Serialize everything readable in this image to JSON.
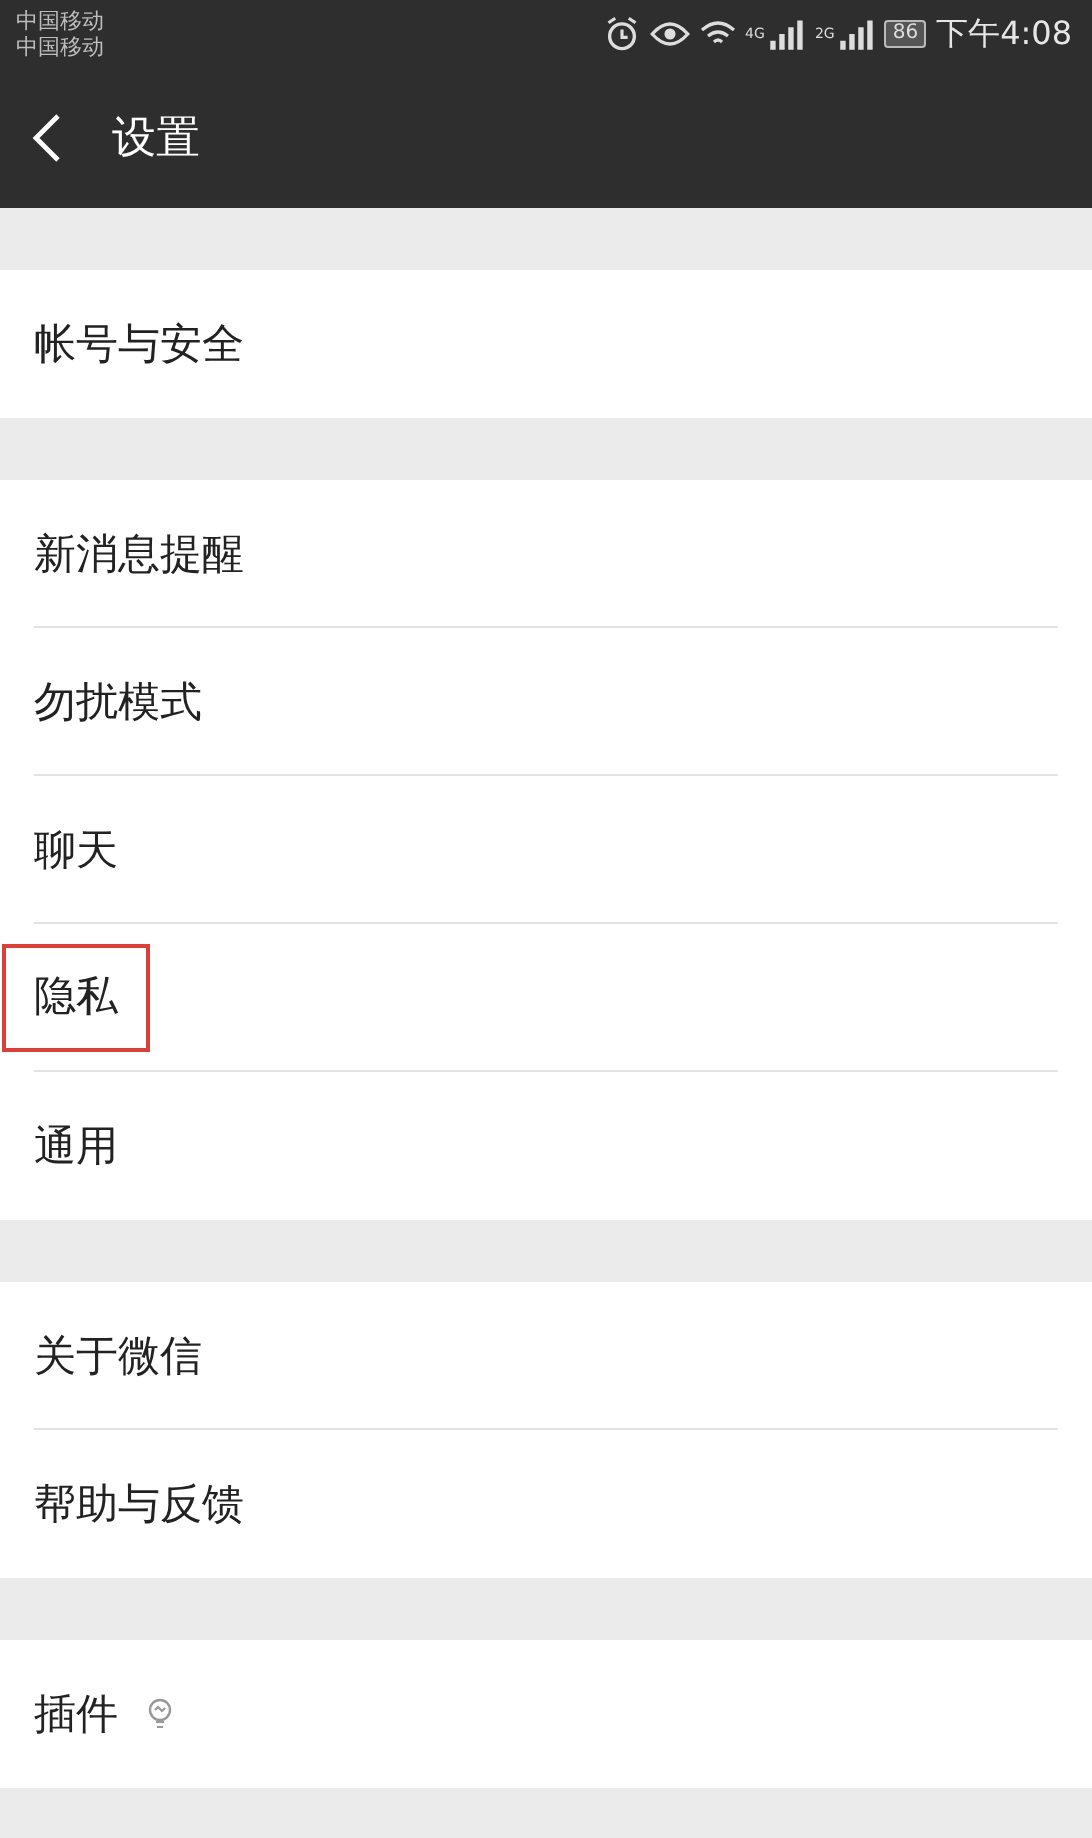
{
  "status_bar": {
    "carriers": [
      "中国移动",
      "中国移动"
    ],
    "network_1": "4G",
    "network_2": "2G",
    "battery": "86",
    "time": "下午4:08"
  },
  "nav_bar": {
    "title": "设置"
  },
  "groups": [
    {
      "items": [
        {
          "label": "帐号与安全",
          "highlighted": false
        }
      ]
    },
    {
      "items": [
        {
          "label": "新消息提醒",
          "highlighted": false
        },
        {
          "label": "勿扰模式",
          "highlighted": false
        },
        {
          "label": "聊天",
          "highlighted": false
        },
        {
          "label": "隐私",
          "highlighted": true
        },
        {
          "label": "通用",
          "highlighted": false
        }
      ]
    },
    {
      "items": [
        {
          "label": "关于微信",
          "highlighted": false
        },
        {
          "label": "帮助与反馈",
          "highlighted": false
        }
      ]
    },
    {
      "items": [
        {
          "label": "插件",
          "highlighted": false,
          "kind": "bulb"
        }
      ]
    }
  ]
}
